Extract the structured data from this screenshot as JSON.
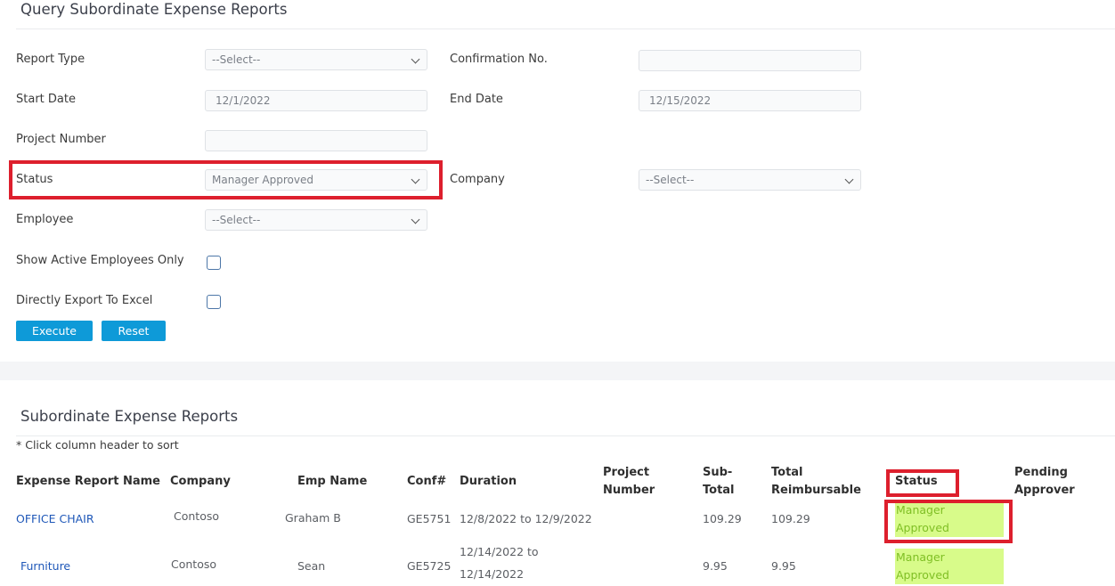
{
  "query": {
    "title": "Query Subordinate Expense Reports",
    "report_type": {
      "label": "Report Type",
      "value": "--Select--"
    },
    "confirmation_no": {
      "label": "Confirmation No.",
      "value": ""
    },
    "start_date": {
      "label": "Start Date",
      "value": "12/1/2022"
    },
    "end_date": {
      "label": "End Date",
      "value": "12/15/2022"
    },
    "project_number": {
      "label": "Project Number",
      "value": ""
    },
    "status": {
      "label": "Status",
      "value": "Manager Approved"
    },
    "company": {
      "label": "Company",
      "value": "--Select--"
    },
    "employee": {
      "label": "Employee",
      "value": "--Select--"
    },
    "show_active": {
      "label": "Show Active Employees Only",
      "checked": false
    },
    "export_excel": {
      "label": "Directly Export To Excel",
      "checked": false
    },
    "execute_label": "Execute",
    "reset_label": "Reset"
  },
  "results": {
    "title": "Subordinate Expense Reports",
    "sort_note": "* Click column header to sort",
    "columns": {
      "name": "Expense Report Name",
      "company": "Company",
      "emp_name": "Emp Name",
      "conf": "Conf#",
      "duration": "Duration",
      "project_line1": "Project",
      "project_line2": "Number",
      "subtotal_line1": "Sub-",
      "subtotal_line2": "Total",
      "total_line1": "Total",
      "total_line2": "Reimbursable",
      "status": "Status",
      "pending_line1": "Pending",
      "pending_line2": "Approver"
    },
    "rows": [
      {
        "name": "OFFICE CHAIR",
        "company": "Contoso",
        "emp_name": "Graham B",
        "conf": "GE5751",
        "duration_line1": "12/8/2022 to 12/9/2022",
        "project_number": "",
        "subtotal": "109.29",
        "total": "109.29",
        "status_line1": "Manager",
        "status_line2": "Approved",
        "pending_approver": ""
      },
      {
        "name": "Furniture",
        "company": "Contoso",
        "emp_name": "Sean",
        "conf": "GE5725",
        "duration_line1": "12/14/2022 to",
        "duration_line2": "12/14/2022",
        "project_number": "",
        "subtotal": "9.95",
        "total": "9.95",
        "status_line1": "Manager",
        "status_line2": "Approved",
        "pending_approver": ""
      }
    ]
  },
  "colors": {
    "button": "#0e9ad8",
    "highlight_border": "#dd1f2d",
    "status_bg": "#d8fb8a",
    "status_text": "#7fbf24",
    "link": "#1e57b8"
  }
}
